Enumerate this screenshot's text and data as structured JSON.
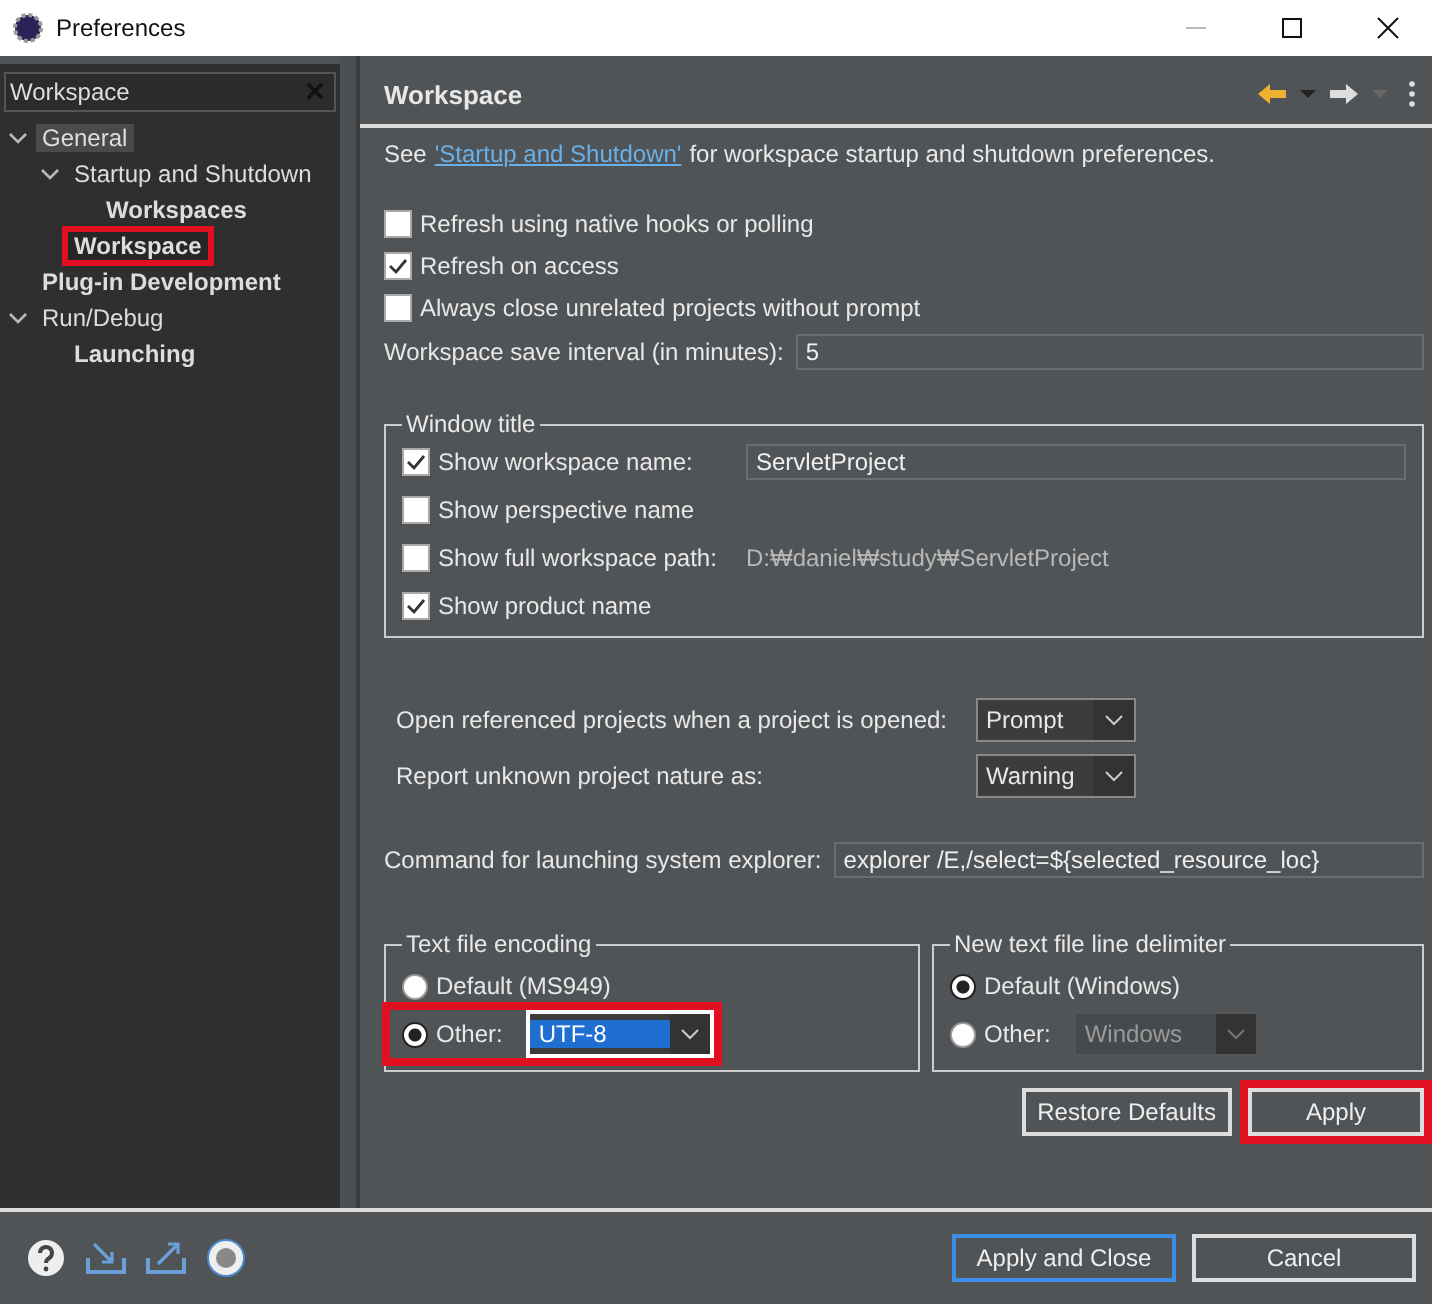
{
  "window": {
    "title": "Preferences"
  },
  "filter": {
    "value": "Workspace"
  },
  "tree": [
    {
      "label": "General",
      "expanded": true,
      "selected": true,
      "matched": false,
      "highlighted": false,
      "children": [
        {
          "label": "Startup and Shutdown",
          "expanded": true,
          "selected": false,
          "matched": false,
          "highlighted": false,
          "children": [
            {
              "label": "Workspaces",
              "selected": false,
              "matched": true,
              "highlighted": false
            }
          ]
        },
        {
          "label": "Workspace",
          "selected": false,
          "matched": true,
          "highlighted": true
        }
      ]
    },
    {
      "label": "Plug-in Development",
      "selected": false,
      "matched": true,
      "highlighted": false
    },
    {
      "label": "Run/Debug",
      "expanded": true,
      "selected": false,
      "matched": false,
      "highlighted": false,
      "children": [
        {
          "label": "Launching",
          "selected": false,
          "matched": true,
          "highlighted": false
        }
      ]
    }
  ],
  "page": {
    "title": "Workspace",
    "intro": {
      "prefix": "See",
      "link": "'Startup and Shutdown'",
      "suffix": "for workspace startup and shutdown preferences."
    },
    "checkboxes": [
      {
        "label": "Refresh using native hooks or polling",
        "checked": false
      },
      {
        "label": "Refresh on access",
        "checked": true
      },
      {
        "label": "Always close unrelated projects without prompt",
        "checked": false
      }
    ],
    "save_interval": {
      "label": "Workspace save interval (in minutes):",
      "value": "5"
    },
    "window_title": {
      "legend": "Window title",
      "options": [
        {
          "kind": "field",
          "label": "Show workspace name:",
          "checked": true,
          "value": "ServletProject"
        },
        {
          "kind": "plain",
          "label": "Show perspective name",
          "checked": false
        },
        {
          "kind": "path",
          "label": "Show full workspace path:",
          "checked": false,
          "value": "D:₩daniel₩study₩ServletProject"
        },
        {
          "kind": "plain",
          "label": "Show product name",
          "checked": true
        }
      ]
    },
    "dropdowns": [
      {
        "label": "Open referenced projects when a project is opened:",
        "value": "Prompt"
      },
      {
        "label": "Report unknown project nature as:",
        "value": "Warning"
      }
    ],
    "explorer": {
      "label": "Command for launching system explorer:",
      "value": "explorer /E,/select=${selected_resource_loc}"
    },
    "encoding": {
      "legend": "Text file encoding",
      "options": [
        {
          "label": "Default (MS949)",
          "selected": false,
          "highlighted": false
        },
        {
          "label": "Other:",
          "selected": true,
          "value": "UTF-8",
          "disabled": false,
          "highlighted": true
        }
      ]
    },
    "delimiter": {
      "legend": "New text file line delimiter",
      "options": [
        {
          "label": "Default (Windows)",
          "selected": true,
          "highlighted": false
        },
        {
          "label": "Other:",
          "selected": false,
          "value": "Windows",
          "disabled": true,
          "highlighted": false
        }
      ]
    },
    "buttons": [
      {
        "label": "Restore Defaults",
        "highlighted": false
      },
      {
        "label": "Apply",
        "highlighted": true
      }
    ]
  },
  "footer_buttons": [
    {
      "label": "Apply and Close",
      "default": true
    },
    {
      "label": "Cancel",
      "default": false
    }
  ]
}
